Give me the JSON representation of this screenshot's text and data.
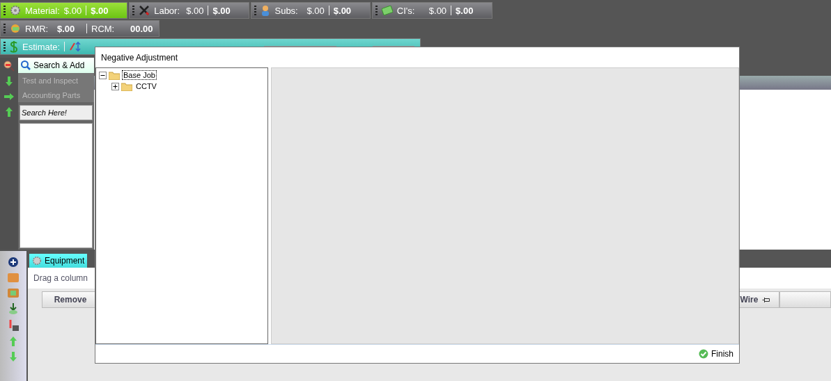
{
  "cost_bar": [
    {
      "kind": "gear",
      "label": "Material:",
      "amount": "$.00",
      "total": "$.00",
      "selected": true
    },
    {
      "kind": "tools",
      "label": "Labor:",
      "amount": "$.00",
      "total": "$.00",
      "selected": false
    },
    {
      "kind": "person",
      "label": "Subs:",
      "amount": "$.00",
      "total": "$.00",
      "selected": false
    },
    {
      "kind": "money",
      "label": "CI's:",
      "amount": "$.00",
      "total": "$.00",
      "selected": false
    }
  ],
  "recurring_bar": {
    "rmr_label": "RMR:",
    "rmr_value": "$.00",
    "rcm_label": "RCM:",
    "rcm_value": "00.00"
  },
  "estimate_bar": {
    "label": "Estimate:"
  },
  "search_panel": {
    "tab": "Search & Add",
    "items": [
      "Test and Inspect",
      "Accounting Parts"
    ],
    "search_placeholder": "Search Here!"
  },
  "equipment_panel": {
    "tab": "Equipment",
    "group_hint": "Drag a column",
    "columns": [
      "Remove",
      "Wire"
    ]
  },
  "dialog": {
    "title": "Negative Adjustment",
    "tree": [
      {
        "label": "Base Job",
        "expanded": true,
        "selected": true,
        "children": [
          {
            "label": "CCTV",
            "expanded": false,
            "selected": false
          }
        ]
      }
    ],
    "finish_button": "Finish"
  }
}
